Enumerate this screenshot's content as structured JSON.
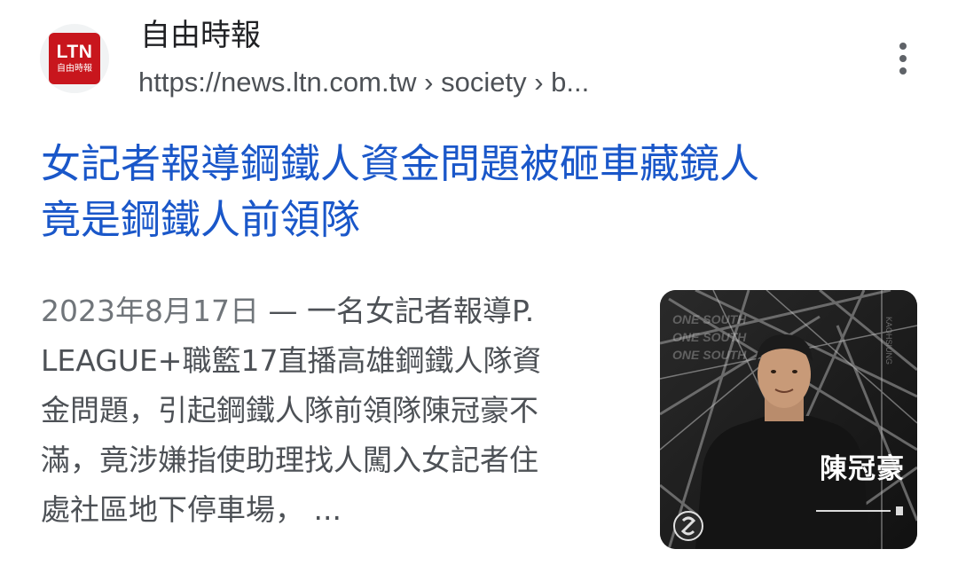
{
  "result": {
    "favicon": {
      "logo_text": "LTN",
      "logo_subtext": "自由時報",
      "icon": "ltn-logo-icon",
      "brand_color": "#c8161d"
    },
    "site_name": "自由時報",
    "url": "https://news.ltn.com.tw › society › b...",
    "more_icon": "more-vert-icon",
    "title": "女記者報導鋼鐵人資金問題被砸車藏鏡人\n竟是鋼鐵人前領隊",
    "title_color": "#1a57c9",
    "snippet_date": "2023年8月17日",
    "snippet_text": "一名女記者報導P.\nLEAGUE+職籃17直播高雄鋼鐵人隊資\n金問題，引起鋼鐵人隊前領隊陳冠豪不\n滿，竟涉嫌指使助理找人闖入女記者住\n處社區地下停車場， ...",
    "snippet_separator": " — ",
    "thumbnail": {
      "name_text": "陳冠豪"
    }
  }
}
